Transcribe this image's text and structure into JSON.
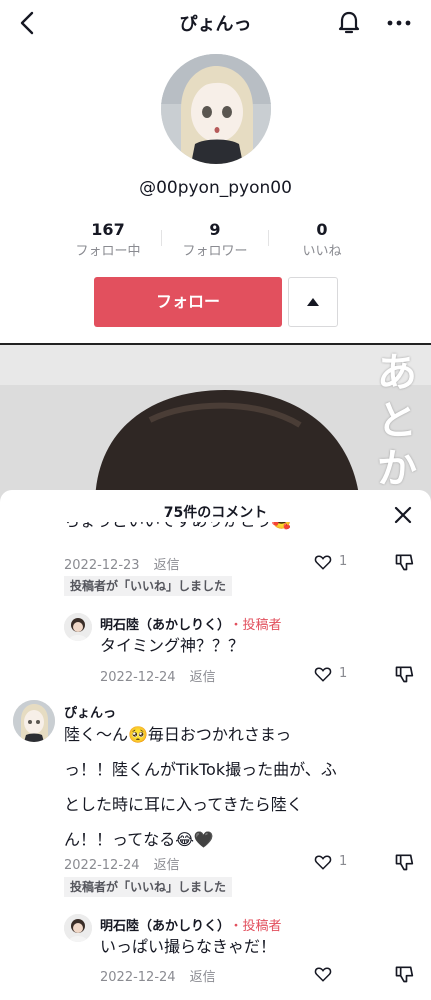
{
  "header": {
    "title": "ぴょんっ"
  },
  "profile": {
    "handle": "@00pyon_pyon00",
    "stats": [
      {
        "num": "167",
        "label": "フォロー中"
      },
      {
        "num": "9",
        "label": "フォロワー"
      },
      {
        "num": "0",
        "label": "いいね"
      }
    ],
    "follow_label": "フォロー"
  },
  "video": {
    "overlay_text": "あとか"
  },
  "comments_sheet": {
    "title": "75件のコメント",
    "c1": {
      "partial_text": "ちょうどいいですありがとう🥰",
      "date": "2022-12-23",
      "reply": "返信",
      "likes": "1",
      "badge": "投稿者が「いいね」しました"
    },
    "r1": {
      "user": "明石陸（あかしりく）",
      "creator": "・投稿者",
      "text": "タイミング神？？？",
      "date": "2022-12-24",
      "reply": "返信",
      "likes": "1"
    },
    "c2": {
      "user": "ぴょんっ",
      "lines": [
        "陸く〜ん🥺毎日おつかれさまっ",
        "っ！！陸くんがTikTok撮った曲が、ふ",
        "とした時に耳に入ってきたら陸く",
        "ん！！ってなる😂🖤"
      ],
      "date": "2022-12-24",
      "reply": "返信",
      "likes": "1",
      "badge": "投稿者が「いいね」しました"
    },
    "r2": {
      "user": "明石陸（あかしりく）",
      "creator": "・投稿者",
      "text": "いっぱい撮らなきゃだ！",
      "date": "2022-12-24",
      "reply": "返信"
    }
  }
}
